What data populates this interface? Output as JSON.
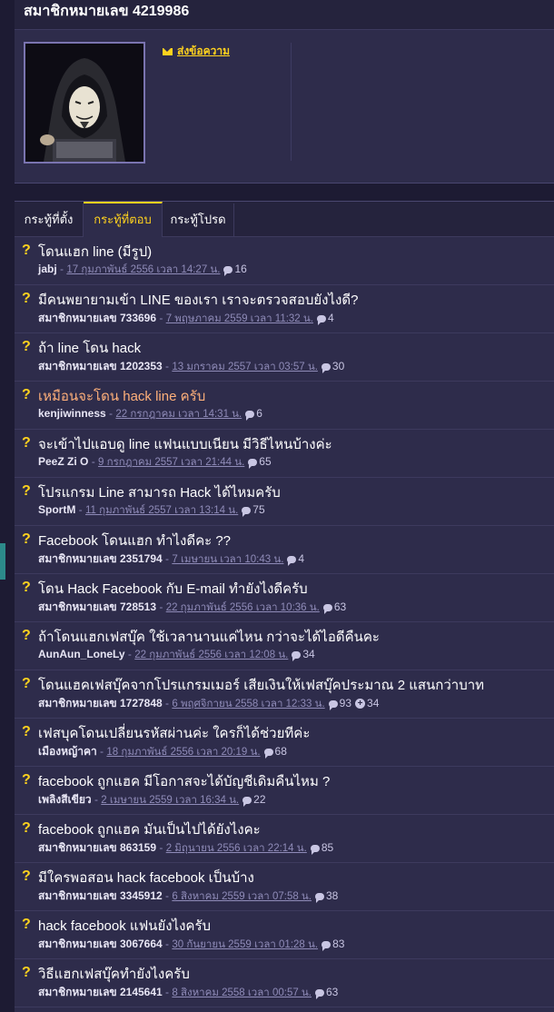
{
  "page_title": "สมาชิกหมายเลข 4219986",
  "profile": {
    "send_message_label": "ส่งข้อความ"
  },
  "tabs": [
    {
      "label": "กระทู้ที่ตั้ง",
      "active": false
    },
    {
      "label": "กระทู้ที่ตอบ",
      "active": true
    },
    {
      "label": "กระทู้โปรด",
      "active": false
    }
  ],
  "topics": [
    {
      "title": "โดนแฮก line (มีรูป)",
      "author": "jabj",
      "date": "17 กุมภาพันธ์ 2556 เวลา 14:27 น.",
      "comments": "16",
      "votes": "",
      "visited": false
    },
    {
      "title": "มีคนพยายามเข้า LINE ของเรา เราจะตรวจสอบยังไงดี?",
      "author": "สมาชิกหมายเลข 733696",
      "date": "7 พฤษภาคม 2559 เวลา 11:32 น.",
      "comments": "4",
      "votes": "",
      "visited": false
    },
    {
      "title": "ถ้า line โดน hack",
      "author": "สมาชิกหมายเลข 1202353",
      "date": "13 มกราคม 2557 เวลา 03:57 น.",
      "comments": "30",
      "votes": "",
      "visited": false
    },
    {
      "title": "เหมือนจะโดน hack line ครับ",
      "author": "kenjiwinness",
      "date": "22 กรกฎาคม เวลา 14:31 น.",
      "comments": "6",
      "votes": "",
      "visited": true
    },
    {
      "title": "จะเข้าไปแอบดู line แฟนแบบเนียน มีวิธีไหนบ้างค่ะ",
      "author": "PeeZ Zi O",
      "date": "9 กรกฎาคม 2557 เวลา 21:44 น.",
      "comments": "65",
      "votes": "",
      "visited": false
    },
    {
      "title": "โปรแกรม Line สามารถ Hack ได้ไหมครับ",
      "author": "SportM",
      "date": "11 กุมภาพันธ์ 2557 เวลา 13:14 น.",
      "comments": "75",
      "votes": "",
      "visited": false
    },
    {
      "title": "Facebook โดนแฮก ทำไงดีคะ ??",
      "author": "สมาชิกหมายเลข 2351794",
      "date": "7 เมษายน เวลา 10:43 น.",
      "comments": "4",
      "votes": "",
      "visited": false
    },
    {
      "title": "โดน Hack Facebook กับ E-mail ทำยังไงดีครับ",
      "author": "สมาชิกหมายเลข 728513",
      "date": "22 กุมภาพันธ์ 2556 เวลา 10:36 น.",
      "comments": "63",
      "votes": "",
      "visited": false
    },
    {
      "title": "ถ้าโดนแฮกเฟสบุ๊ค ใช้เวลานานแค่ไหน กว่าจะได้ไอดีคืนคะ",
      "author": "AunAun_LoneLy",
      "date": "22 กุมภาพันธ์ 2556 เวลา 12:08 น.",
      "comments": "34",
      "votes": "",
      "visited": false
    },
    {
      "title": "โดนแฮคเฟสบุ๊คจากโปรแกรมเมอร์ เสียเงินให้เฟสบุ๊คประมาณ 2 แสนกว่าบาท",
      "author": "สมาชิกหมายเลข 1727848",
      "date": "6 พฤศจิกายน 2558 เวลา 12:33 น.",
      "comments": "93",
      "votes": "34",
      "visited": false
    },
    {
      "title": "เฟสบุคโดนเปลี่ยนรหัสผ่านค่ะ ใครก็ได้ช่วยทีค่ะ",
      "author": "เมืองหญ้าคา",
      "date": "18 กุมภาพันธ์ 2556 เวลา 20:19 น.",
      "comments": "68",
      "votes": "",
      "visited": false
    },
    {
      "title": "facebook ถูกแฮค มีโอกาสจะได้บัญชีเดิมคืนไหม ?",
      "author": "เพลิงสีเขียว",
      "date": "2 เมษายน 2559 เวลา 16:34 น.",
      "comments": "22",
      "votes": "",
      "visited": false
    },
    {
      "title": "facebook ถูกแฮค มันเป็นไปได้ยังไงคะ",
      "author": "สมาชิกหมายเลข 863159",
      "date": "2 มิถุนายน 2556 เวลา 22:14 น.",
      "comments": "85",
      "votes": "",
      "visited": false
    },
    {
      "title": "มีใครพอสอน hack facebook เป็นบ้าง",
      "author": "สมาชิกหมายเลข 3345912",
      "date": "6 สิงหาคม 2559 เวลา 07:58 น.",
      "comments": "38",
      "votes": "",
      "visited": false
    },
    {
      "title": "hack facebook แฟนยังไงครับ",
      "author": "สมาชิกหมายเลข 3067664",
      "date": "30 กันยายน 2559 เวลา 01:28 น.",
      "comments": "83",
      "votes": "",
      "visited": false
    },
    {
      "title": "วิธีแฮกเฟสบุ๊คทำยังไงครับ",
      "author": "สมาชิกหมายเลข 2145641",
      "date": "8 สิงหาคม 2558 เวลา 00:57 น.",
      "comments": "63",
      "votes": "",
      "visited": false
    }
  ]
}
